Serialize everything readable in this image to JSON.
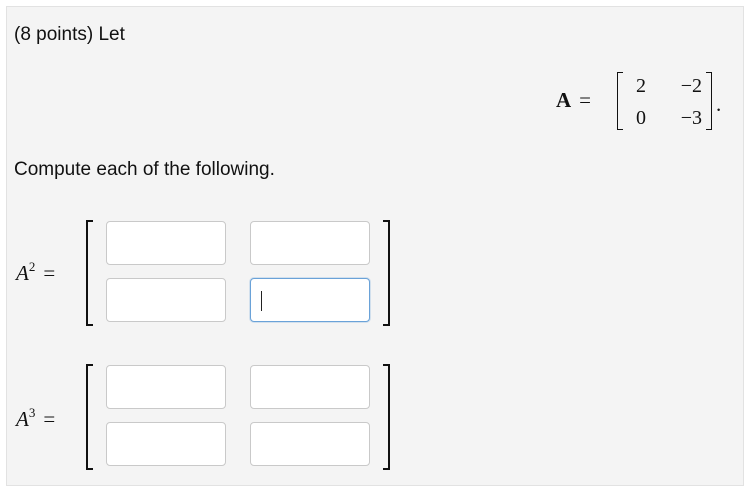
{
  "question": {
    "intro": "(8 points) Let",
    "instruction": "Compute each of the following."
  },
  "matrix_a": {
    "symbol": "A",
    "equals": "=",
    "rows": [
      [
        "2",
        "−2"
      ],
      [
        "0",
        "−3"
      ]
    ],
    "trailing": "."
  },
  "answers": [
    {
      "base": "A",
      "exponent": "2",
      "equals": "=",
      "cells": [
        "",
        "",
        "",
        ""
      ],
      "focused_cell": 3
    },
    {
      "base": "A",
      "exponent": "3",
      "equals": "=",
      "cells": [
        "",
        "",
        "",
        ""
      ]
    }
  ]
}
